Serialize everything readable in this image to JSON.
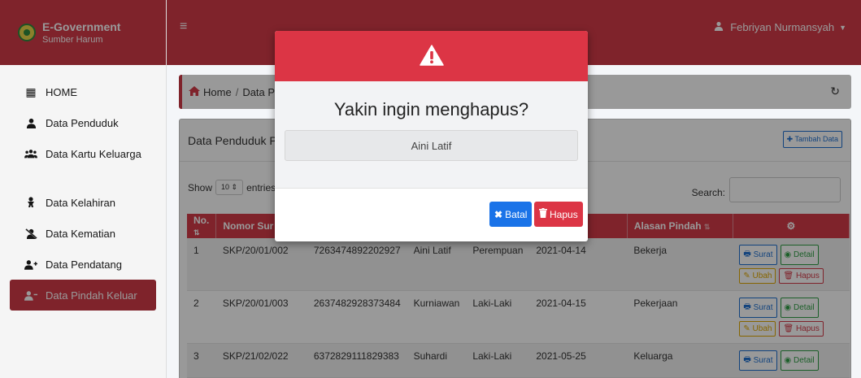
{
  "brand": {
    "title": "E-Government",
    "subtitle": "Sumber Harum"
  },
  "sidebar": {
    "items": [
      {
        "label": "HOME",
        "icon": "grid-icon"
      },
      {
        "label": "Data Penduduk",
        "icon": "user-icon"
      },
      {
        "label": "Data Kartu Keluarga",
        "icon": "users-icon"
      },
      {
        "label": "Data Kelahiran",
        "icon": "baby-icon"
      },
      {
        "label": "Data Kematian",
        "icon": "user-slash-icon"
      },
      {
        "label": "Data Pendatang",
        "icon": "user-plus-icon"
      },
      {
        "label": "Data Pindah Keluar",
        "icon": "user-minus-icon"
      }
    ]
  },
  "topbar": {
    "menu_icon": "hamburger-icon",
    "user_name": "Febriyan Nurmansyah"
  },
  "breadcrumb": {
    "home": "Home",
    "current": "Data Pen"
  },
  "card": {
    "title": "Data Penduduk Pin",
    "add_button": "Tambah Data",
    "show_label": "Show",
    "length_value": "10",
    "entries_label": "entries",
    "search_label": "Search:"
  },
  "table": {
    "headers": [
      "No.",
      "Nomor Sur",
      "",
      "",
      "",
      "",
      "Alasan Pindah",
      ""
    ],
    "rows": [
      {
        "no": "1",
        "nomor": "SKP/20/01/002",
        "nik": "7263474892202927",
        "nama": "Aini Latif",
        "jk": "Perempuan",
        "tanggal": "2021-04-14",
        "alasan": "Bekerja"
      },
      {
        "no": "2",
        "nomor": "SKP/20/01/003",
        "nik": "2637482928373484",
        "nama": "Kurniawan",
        "jk": "Laki-Laki",
        "tanggal": "2021-04-15",
        "alasan": "Pekerjaan"
      },
      {
        "no": "3",
        "nomor": "SKP/21/02/022",
        "nik": "6372829111829383",
        "nama": "Suhardi",
        "jk": "Laki-Laki",
        "tanggal": "2021-05-25",
        "alasan": "Keluarga"
      }
    ],
    "actions": {
      "surat": "Surat",
      "detail": "Detail",
      "ubah": "Ubah",
      "hapus": "Hapus"
    }
  },
  "modal": {
    "icon": "warning-icon",
    "question": "Yakin ingin menghapus?",
    "name": "Aini Latif",
    "cancel_label": "Batal",
    "delete_label": "Hapus"
  },
  "colors": {
    "primary_red": "#d33a48",
    "modal_red": "#dc3545",
    "blue": "#1a73e8",
    "green": "#2f9e44",
    "yellow": "#e0a800"
  }
}
